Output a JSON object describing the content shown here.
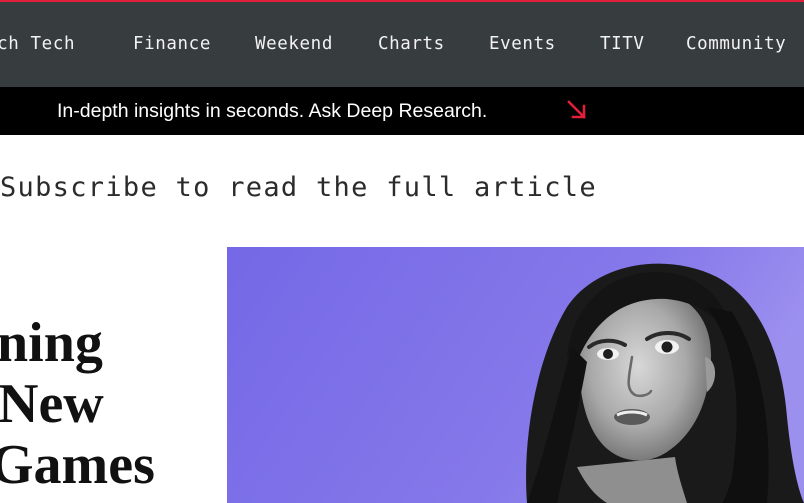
{
  "nav": {
    "items": [
      {
        "label": "rch Tech"
      },
      {
        "label": "Finance"
      },
      {
        "label": "Weekend"
      },
      {
        "label": "Charts"
      },
      {
        "label": "Events"
      },
      {
        "label": "TITV"
      },
      {
        "label": "Community"
      }
    ]
  },
  "promo": {
    "text": "In-depth insights in seconds. Ask Deep Research.",
    "arrow_icon": "arrow-down-right-icon",
    "arrow_color": "#e0203a"
  },
  "article": {
    "subscribe_text": "Subscribe to read the full article",
    "headline_lines": [
      "ning",
      "New",
      "Games"
    ]
  },
  "colors": {
    "accent": "#e0203a",
    "nav_background": "#373c3e",
    "promo_background": "#000000",
    "hero_background": "#7f73e6"
  }
}
